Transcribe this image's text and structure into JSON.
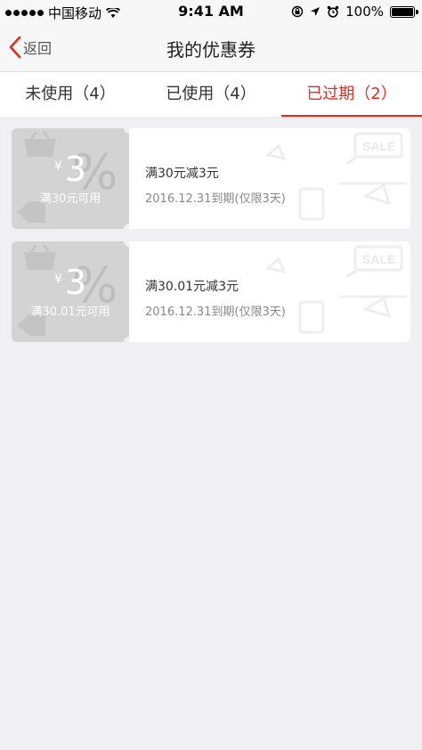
{
  "status_bar": {
    "carrier": "中国移动",
    "time": "9:41 AM",
    "battery": "100%",
    "battery_level": 1.0
  },
  "nav": {
    "back_label": "返回",
    "title": "我的优惠券"
  },
  "tabs": [
    {
      "label": "未使用（4）",
      "active": false
    },
    {
      "label": "已使用（4）",
      "active": false
    },
    {
      "label": "已过期（2）",
      "active": true
    }
  ],
  "coupons": [
    {
      "currency": "¥",
      "amount": "3",
      "percent_mark": "%",
      "condition": "满30元可用",
      "title": "满30元减3元",
      "expiry": "2016.12.31到期(仅限3天)"
    },
    {
      "currency": "¥",
      "amount": "3",
      "percent_mark": "%",
      "condition": "满30.01元可用",
      "title": "满30.01元减3元",
      "expiry": "2016.12.31到期(仅限3天)"
    }
  ],
  "decoration": {
    "sale_text": "SALE"
  },
  "colors": {
    "accent": "#e02e24",
    "stub": "#d3d3d3",
    "background": "#efeff4"
  }
}
